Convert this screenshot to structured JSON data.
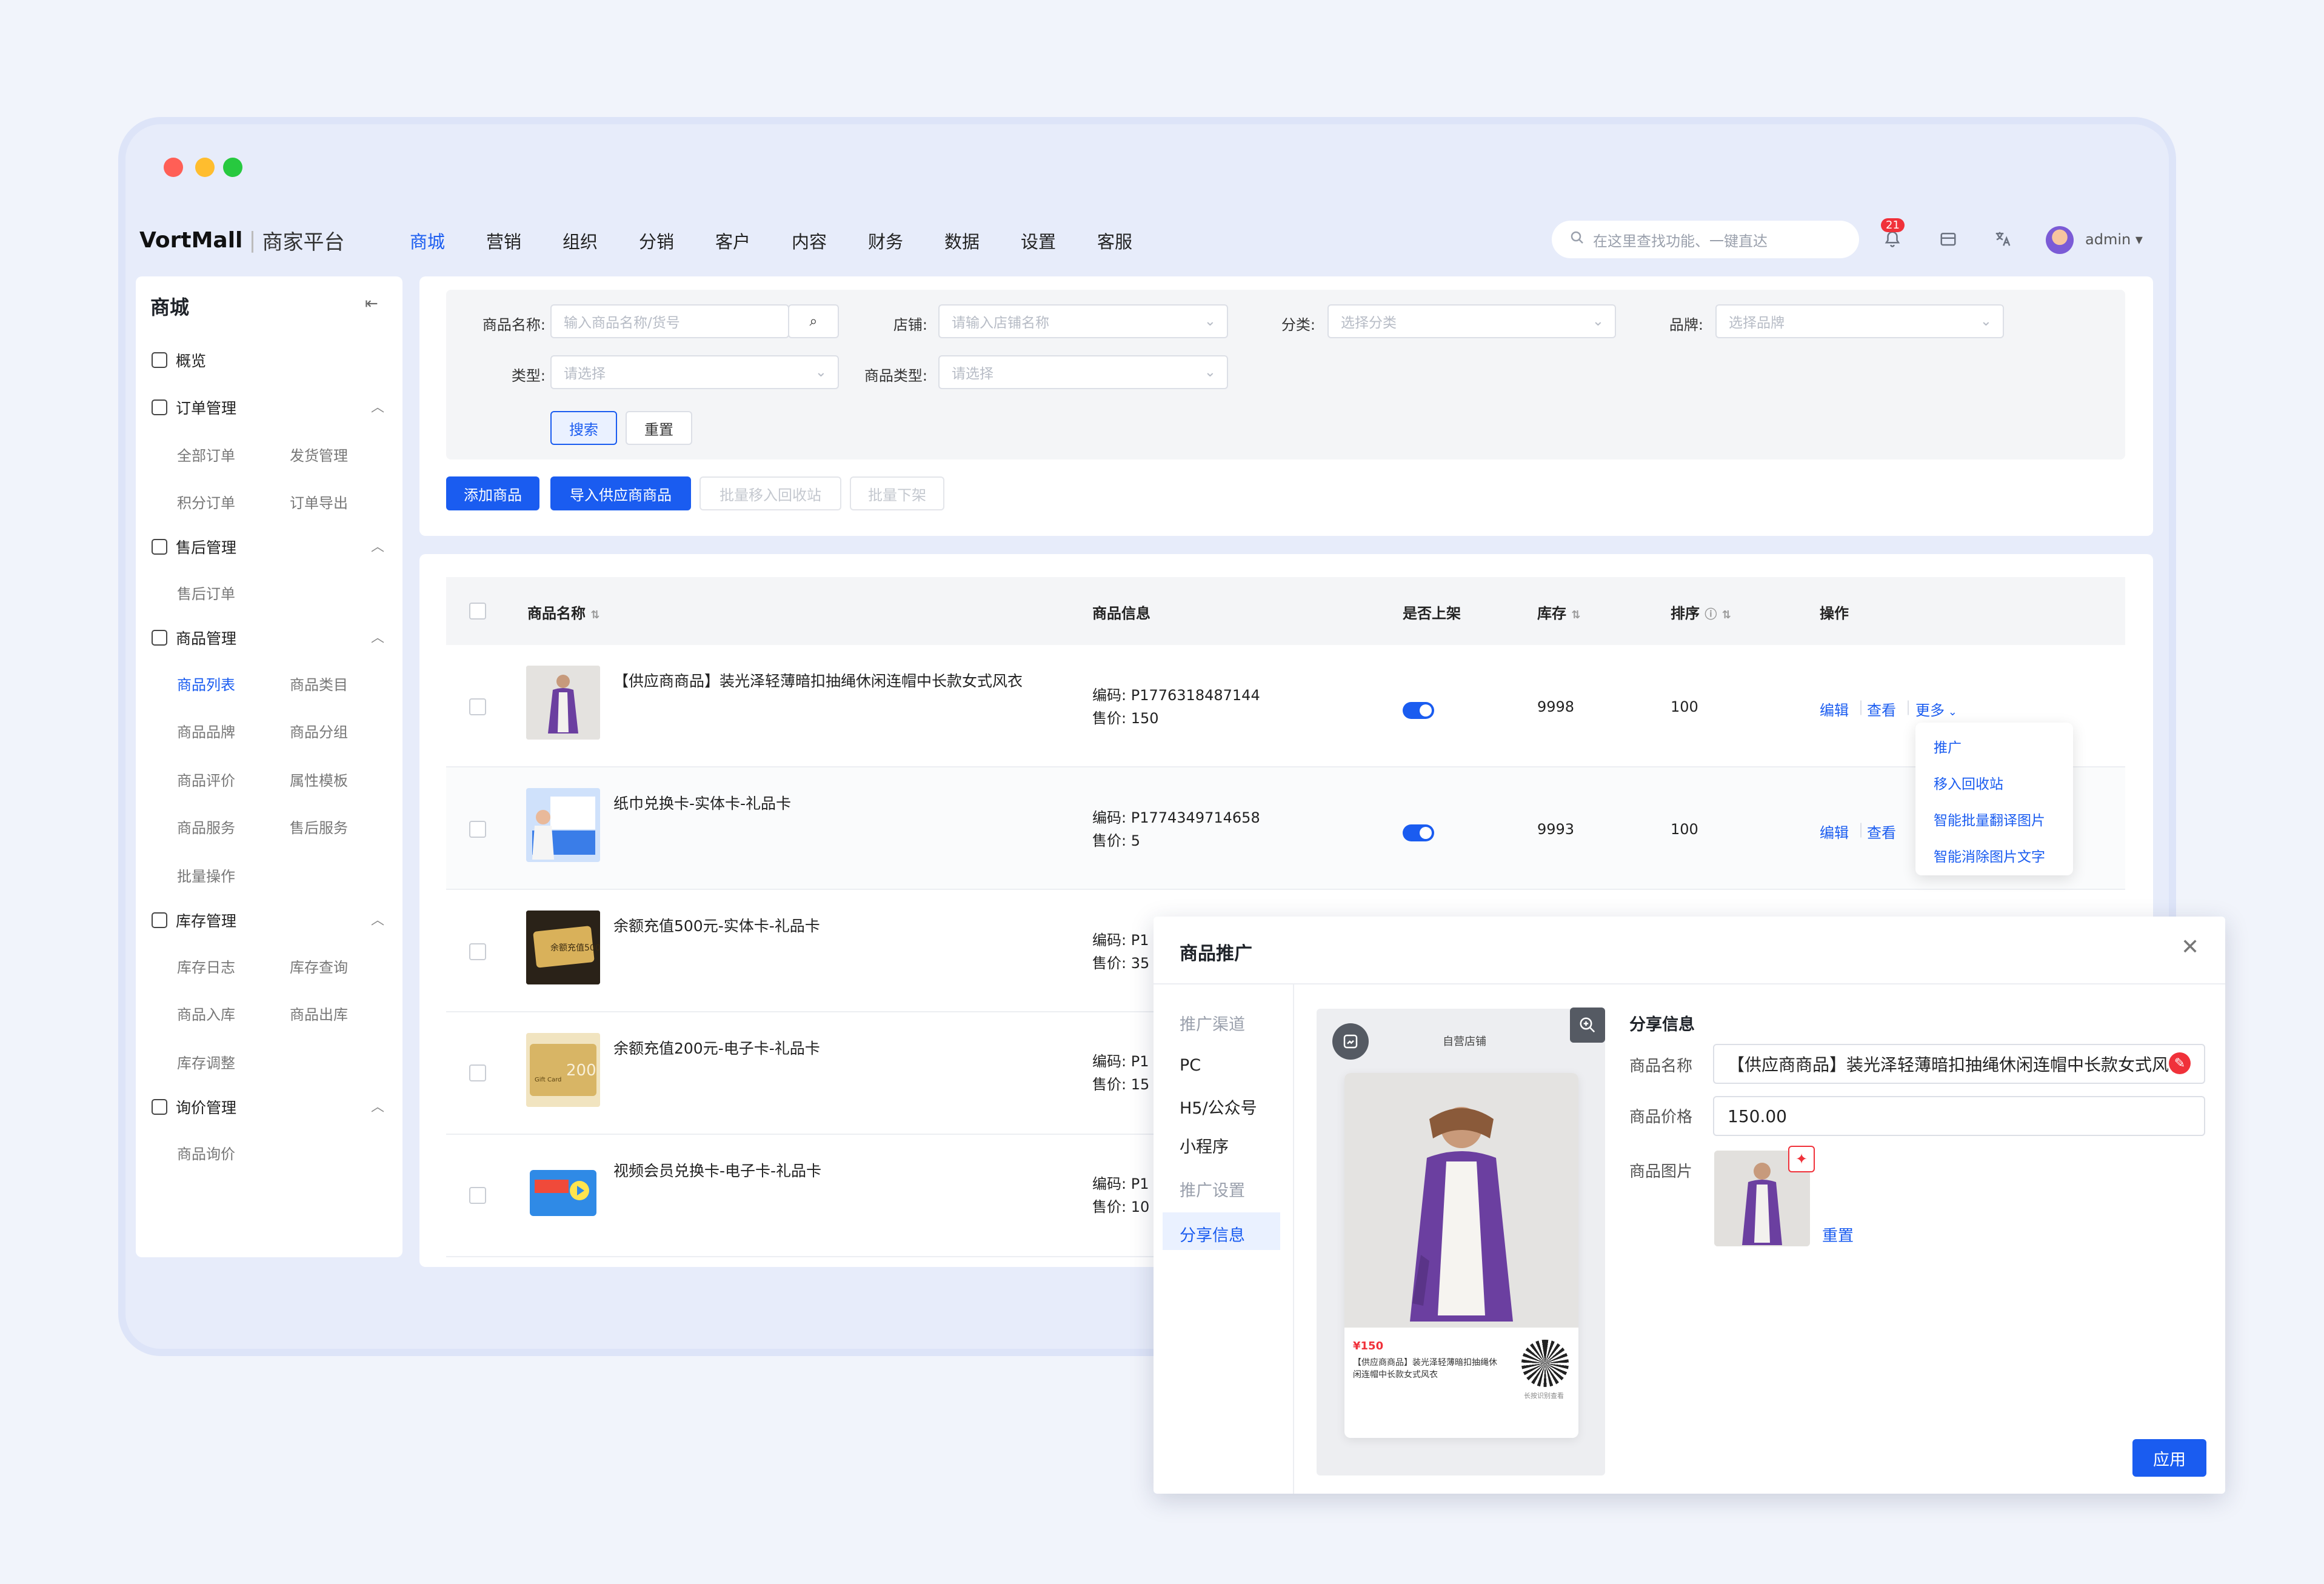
{
  "brand": {
    "logo": "VortMall",
    "sub": "商家平台"
  },
  "nav": [
    "商城",
    "营销",
    "组织",
    "分销",
    "客户",
    "内容",
    "财务",
    "数据",
    "设置",
    "客服"
  ],
  "search": {
    "placeholder": "在这里查找功能、一键直达"
  },
  "notifications": {
    "count": "21"
  },
  "user": {
    "name": "admin"
  },
  "sidebar": {
    "title": "商城",
    "overview": "概览",
    "groups": [
      {
        "label": "订单管理",
        "items": [
          "全部订单",
          "发货管理",
          "积分订单",
          "订单导出"
        ]
      },
      {
        "label": "售后管理",
        "items": [
          "售后订单"
        ]
      },
      {
        "label": "商品管理",
        "items": [
          "商品列表",
          "商品类目",
          "商品品牌",
          "商品分组",
          "商品评价",
          "属性模板",
          "商品服务",
          "售后服务",
          "批量操作"
        ]
      },
      {
        "label": "库存管理",
        "items": [
          "库存日志",
          "库存查询",
          "商品入库",
          "商品出库",
          "库存调整"
        ]
      },
      {
        "label": "询价管理",
        "items": [
          "商品询价"
        ]
      }
    ]
  },
  "filters": {
    "name_label": "商品名称:",
    "name_placeholder": "输入商品名称/货号",
    "store_label": "店铺:",
    "store_placeholder": "请输入店铺名称",
    "category_label": "分类:",
    "category_placeholder": "选择分类",
    "brand_label": "品牌:",
    "brand_placeholder": "选择品牌",
    "type_label": "类型:",
    "type_placeholder": "请选择",
    "ptype_label": "商品类型:",
    "ptype_placeholder": "请选择",
    "search_btn": "搜索",
    "reset_btn": "重置"
  },
  "actions": {
    "add": "添加商品",
    "import": "导入供应商商品",
    "recycle": "批量移入回收站",
    "offshelf": "批量下架"
  },
  "table": {
    "headers": {
      "name": "商品名称",
      "info": "商品信息",
      "onshelf": "是否上架",
      "stock": "库存",
      "sort": "排序",
      "ops": "操作"
    },
    "code_prefix": "编码:",
    "price_prefix": "售价:",
    "rows": [
      {
        "name": "【供应商商品】装光泽轻薄暗扣抽绳休闲连帽中长款女式风衣",
        "code": "P1776318487144",
        "price": "150",
        "stock": "9998",
        "sort": "100",
        "edit": "编辑",
        "view": "查看",
        "more": "更多"
      },
      {
        "name": "纸巾兑换卡-实体卡-礼品卡",
        "code": "P1774349714658",
        "price": "5",
        "stock": "9993",
        "sort": "100",
        "edit": "编辑",
        "view": "查看"
      },
      {
        "name": "余额充值500元-实体卡-礼品卡",
        "code": "P1",
        "price": "35"
      },
      {
        "name": "余额充值200元-电子卡-礼品卡",
        "code": "P1",
        "price": "15"
      },
      {
        "name": "视频会员兑换卡-电子卡-礼品卡",
        "code": "P1",
        "price": "10"
      }
    ]
  },
  "more_menu": [
    "推广",
    "移入回收站",
    "智能批量翻译图片",
    "智能消除图片文字"
  ],
  "modal": {
    "title": "商品推广",
    "channels_head": "推广渠道",
    "channels": [
      "PC",
      "H5/公众号",
      "小程序"
    ],
    "settings_head": "推广设置",
    "active_item": "分享信息",
    "preview": {
      "store": "自营店铺",
      "price": "¥150",
      "desc": "【供应商商品】装光泽轻薄暗扣抽绳休闲连帽中长款女式风衣",
      "qr_note": "长按识别查看"
    },
    "share_title": "分享信息",
    "fields": {
      "name_label": "商品名称",
      "name_value": "【供应商商品】装光泽轻薄暗扣抽绳休闲连帽中长款女式风衣",
      "price_label": "商品价格",
      "price_value": "150.00",
      "image_label": "商品图片"
    },
    "reset": "重置",
    "apply": "应用"
  },
  "thumb_texts": {
    "card500": "余额充值500元",
    "card200": "200",
    "gift": "Gift Card"
  },
  "colors": {
    "accent": "#1a5cf0",
    "dot_red": "#ff5f56",
    "dot_yellow": "#ffbd2e",
    "dot_green": "#27c93f",
    "dress": "#6b3fa0"
  }
}
